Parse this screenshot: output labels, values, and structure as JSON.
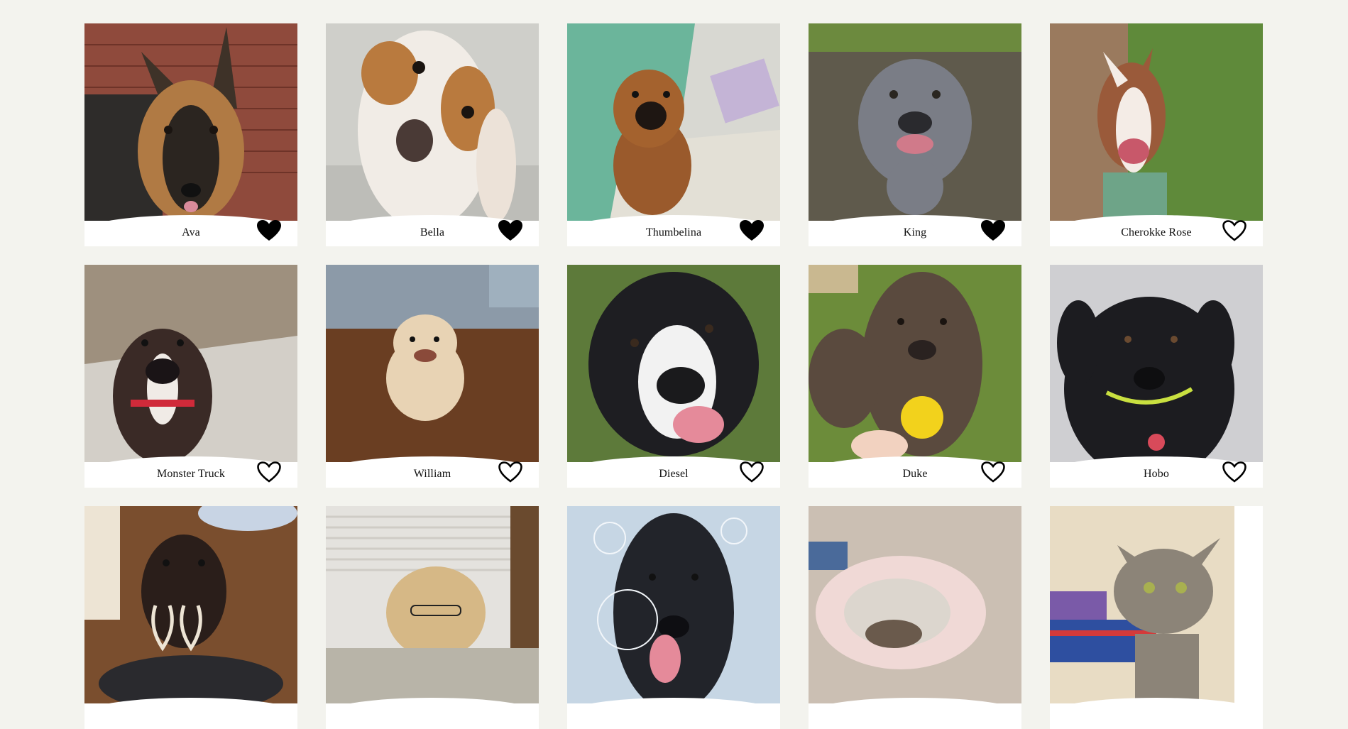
{
  "pets": [
    {
      "name": "Ava",
      "favorited": true,
      "bg": "#8f4a3c",
      "fg": "#4a3a2e",
      "accent": "#c0925e",
      "icon": "heart-icon"
    },
    {
      "name": "Bella",
      "favorited": true,
      "bg": "#cfcfca",
      "fg": "#f1ece6",
      "accent": "#b97a3e",
      "icon": "heart-icon"
    },
    {
      "name": "Thumbelina",
      "favorited": true,
      "bg": "#6bb59b",
      "fg": "#9a5a2c",
      "accent": "#e3e0d6",
      "icon": "heart-icon"
    },
    {
      "name": "King",
      "favorited": true,
      "bg": "#5f5a4c",
      "fg": "#7a7d86",
      "accent": "#6c8a3e",
      "icon": "heart-icon"
    },
    {
      "name": "Cherokke Rose",
      "favorited": false,
      "bg": "#5f8a3a",
      "fg": "#f4ece6",
      "accent": "#9a5a3a",
      "icon": "heart-outline-icon"
    },
    {
      "name": "Monster Truck",
      "favorited": false,
      "bg": "#9e907e",
      "fg": "#3a2a26",
      "accent": "#d3cfc8",
      "icon": "heart-outline-icon"
    },
    {
      "name": "William",
      "favorited": false,
      "bg": "#6a3e22",
      "fg": "#e8d3b4",
      "accent": "#8c9aa8",
      "icon": "heart-outline-icon"
    },
    {
      "name": "Diesel",
      "favorited": false,
      "bg": "#5d7a3a",
      "fg": "#1e1e22",
      "accent": "#f2f2f2",
      "icon": "heart-outline-icon"
    },
    {
      "name": "Duke",
      "favorited": false,
      "bg": "#6c8c3a",
      "fg": "#5a4a3e",
      "accent": "#f2d21c",
      "icon": "heart-outline-icon"
    },
    {
      "name": "Hobo",
      "favorited": false,
      "bg": "#cfcfd2",
      "fg": "#1c1c20",
      "accent": "#c9e040",
      "icon": "heart-outline-icon"
    },
    {
      "name": "",
      "favorited": false,
      "bg": "#7a4e2e",
      "fg": "#2a1e1a",
      "accent": "#ede4d4",
      "icon": "heart-outline-icon"
    },
    {
      "name": "",
      "favorited": false,
      "bg": "#e4e2de",
      "fg": "#d6b886",
      "accent": "#b8b4a8",
      "icon": "heart-outline-icon"
    },
    {
      "name": "",
      "favorited": false,
      "bg": "#c6d6e4",
      "fg": "#22242a",
      "accent": "#e58a9a",
      "icon": "heart-outline-icon"
    },
    {
      "name": "",
      "favorited": false,
      "bg": "#cbbfb3",
      "fg": "#dcd6ce",
      "accent": "#f0d9d6",
      "icon": "heart-outline-icon"
    },
    {
      "name": "",
      "favorited": false,
      "bg": "#e8dcc4",
      "fg": "#8c8478",
      "accent": "#2e4fa0",
      "icon": "heart-outline-icon"
    }
  ]
}
